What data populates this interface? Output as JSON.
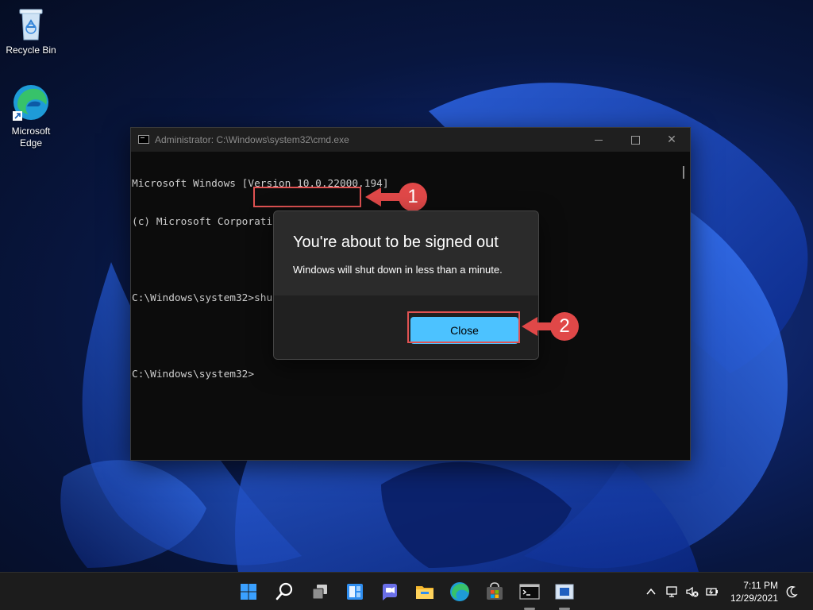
{
  "desktop": {
    "icons": [
      {
        "label": "Recycle Bin"
      },
      {
        "label": "Microsoft\nEdge"
      }
    ]
  },
  "cmd_window": {
    "title": "Administrator: C:\\Windows\\system32\\cmd.exe",
    "lines": [
      "Microsoft Windows [Version 10.0.22000.194]",
      "(c) Microsoft Corporation. All rights reserved.",
      "",
      "C:\\Windows\\system32>shutdown /r /o",
      "",
      "C:\\Windows\\system32>"
    ]
  },
  "callouts": {
    "one": "1",
    "two": "2",
    "color": "#e04848"
  },
  "dialog": {
    "title": "You're about to be signed out",
    "message": "Windows will shut down in less than a minute.",
    "close_label": "Close",
    "accent": "#4cc2ff"
  },
  "taskbar": {
    "apps": [
      "start-icon",
      "search-icon",
      "task-view-icon",
      "widgets-icon",
      "chat-icon",
      "file-explorer-icon",
      "edge-icon",
      "store-icon",
      "command-prompt-icon",
      "window-app-icon"
    ],
    "time": "7:11 PM",
    "date": "12/29/2021"
  }
}
